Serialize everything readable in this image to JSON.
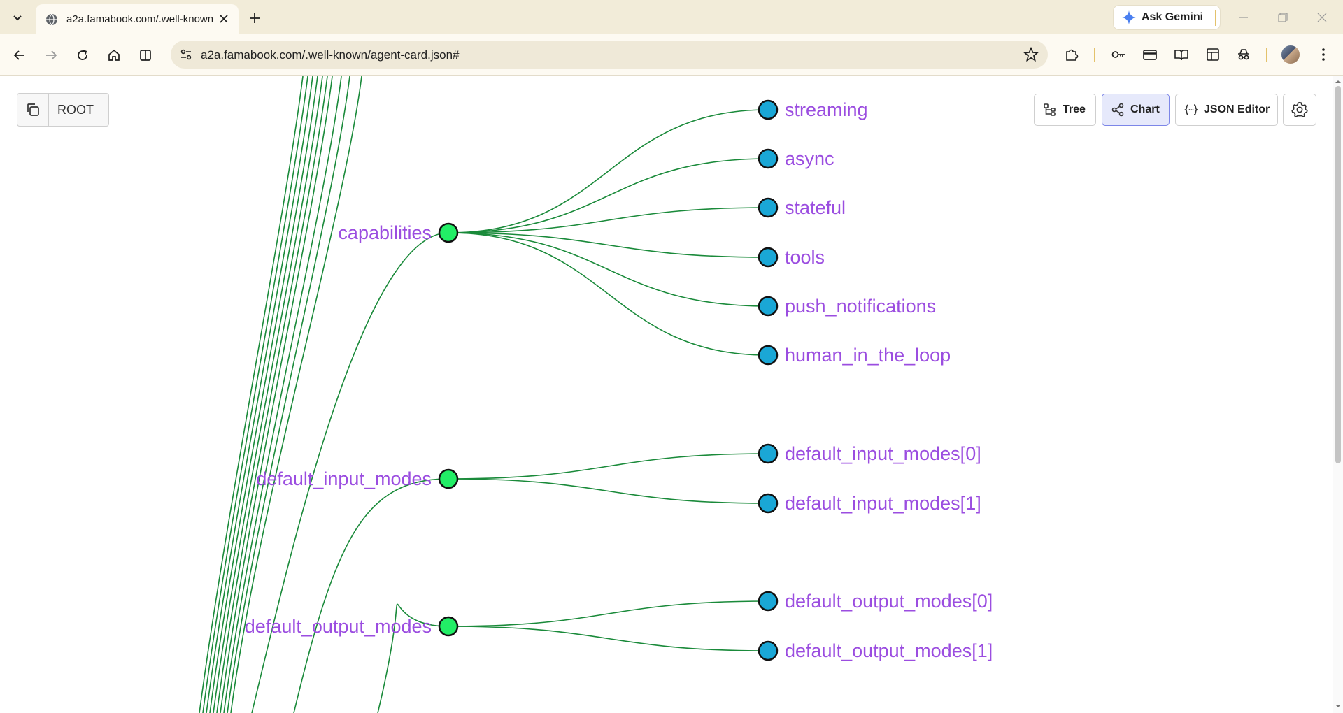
{
  "browser": {
    "tab_title": "a2a.famabook.com/.well-known/agent-card.json",
    "url": "a2a.famabook.com/.well-known/agent-card.json#",
    "gemini_label": "Ask Gemini"
  },
  "app": {
    "root_label": "ROOT",
    "views": [
      {
        "label": "Tree",
        "active": false
      },
      {
        "label": "Chart",
        "active": true
      },
      {
        "label": "JSON Editor",
        "active": false
      }
    ]
  },
  "graph": {
    "groups": [
      {
        "name": "capabilities",
        "children": [
          "streaming",
          "async",
          "stateful",
          "tools",
          "push_notifications",
          "human_in_the_loop"
        ]
      },
      {
        "name": "default_input_modes",
        "children": [
          "default_input_modes[0]",
          "default_input_modes[1]"
        ]
      },
      {
        "name": "default_output_modes",
        "children": [
          "default_output_modes[0]",
          "default_output_modes[1]"
        ]
      }
    ],
    "colors": {
      "link": "#1a8a3a",
      "branch_node": "#22ee66",
      "leaf_node": "#1aa7d6",
      "label": "#9b4de0"
    }
  }
}
